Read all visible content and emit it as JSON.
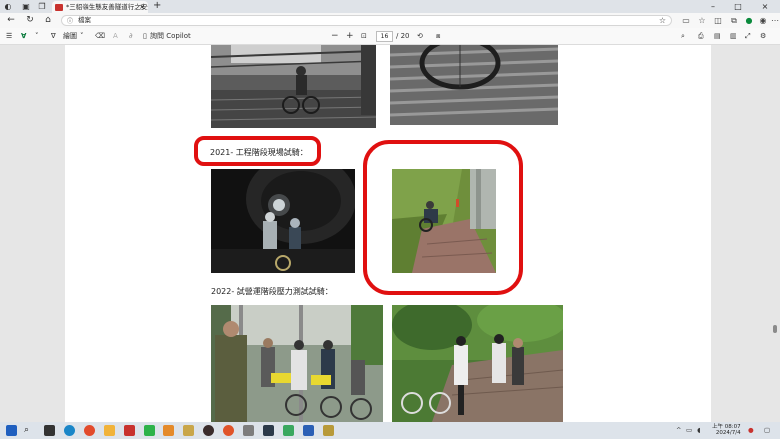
{
  "tab": {
    "title": "*三貂嶺生態友善隧道行之安全"
  },
  "address": {
    "placeholder": "檔案"
  },
  "pdf_toolbar": {
    "draw_label": "繪圖",
    "ask_copilot_label": "詢問 Copilot",
    "zoom_out": "−",
    "zoom_in": "+",
    "page_current": "16",
    "page_total": "/ 20"
  },
  "document": {
    "caption_2021": "2021- 工程階段現場試騎：",
    "caption_2022": "2022- 試營運階段壓力測試試騎："
  },
  "taskbar": {
    "time": "上午 08:07",
    "date": "2024/7/4"
  },
  "colors": {
    "highlight_red": "#e01010",
    "accent_green": "#0a7a3c"
  },
  "icons": {
    "window": [
      "app-logo-icon",
      "workspaces-icon",
      "tab-list-icon"
    ],
    "nav": [
      "back-icon",
      "refresh-icon",
      "home-icon",
      "info-icon",
      "favorite-star-icon"
    ],
    "extensions": [
      "read-aloud-icon",
      "favorites-icon",
      "split-screen-icon",
      "collections-icon",
      "extension-icon",
      "profile-icon",
      "more-icon"
    ]
  }
}
